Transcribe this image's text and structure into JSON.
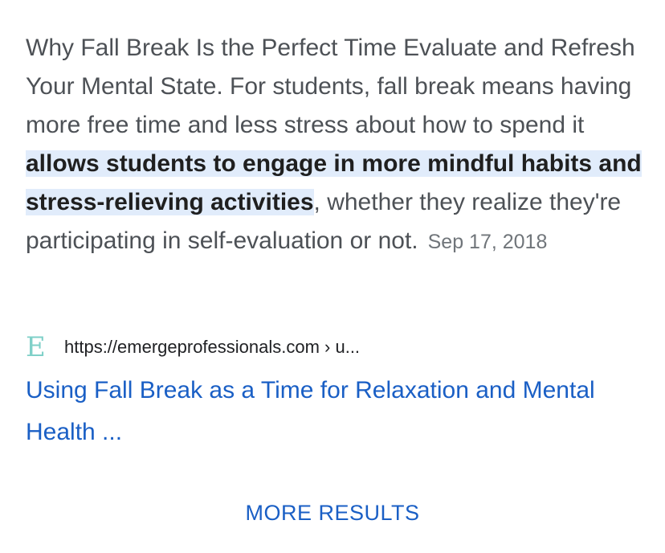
{
  "snippet": {
    "text_before": "Why Fall Break Is the Perfect Time Evaluate and Refresh Your Mental State. For students, fall break means having more free time and less stress about how to spend it ",
    "highlight": "allows students to engage in more mindful habits and stress-relieving activities",
    "text_after": ", whether they realize they're participating in self-evaluation or not.",
    "date": "Sep 17, 2018"
  },
  "result": {
    "favicon_letter": "E",
    "url": "https://emergeprofessionals.com › u...",
    "title": "Using Fall Break as a Time for Relaxation and Mental Health ..."
  },
  "more_results_label": "MORE RESULTS",
  "colors": {
    "link": "#1a5fc5",
    "highlight_bg": "#e1ecfb",
    "body_text": "#4d5156",
    "favicon": "#7fd0c8"
  }
}
